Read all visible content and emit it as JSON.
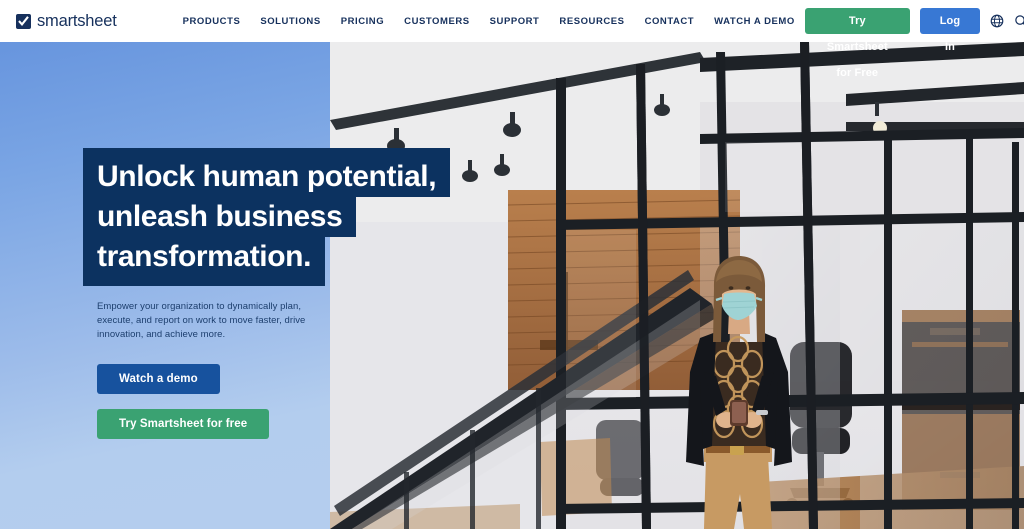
{
  "brand": {
    "name": "smartsheet",
    "logo_icon": "smartsheet-check-logo",
    "navy": "#16305c",
    "green": "#3aa272",
    "blue": "#3878d4"
  },
  "header": {
    "nav_items": [
      {
        "label": "PRODUCTS"
      },
      {
        "label": "SOLUTIONS"
      },
      {
        "label": "PRICING"
      },
      {
        "label": "CUSTOMERS"
      },
      {
        "label": "SUPPORT"
      },
      {
        "label": "RESOURCES"
      },
      {
        "label": "CONTACT"
      },
      {
        "label": "WATCH A DEMO"
      }
    ],
    "trial_button": "Try Smartsheet for Free",
    "login_button": "Log In",
    "globe_icon": "globe-icon",
    "search_icon": "search-icon"
  },
  "hero": {
    "headline_lines": [
      "Unlock human potential,",
      "unleash business",
      "transformation."
    ],
    "subcopy": "Empower your organization to dynamically plan, execute, and report on work to move faster, drive innovation, and achieve more.",
    "cta_demo": "Watch a demo",
    "cta_trial": "Try Smartsheet for free",
    "headline_bg": "#0c3260",
    "panel_gradient_from": "#6795de",
    "panel_gradient_to": "#b4cdee",
    "image_alt": "Woman wearing a face mask using a smartphone in a modern office with glass partitions and a staircase"
  }
}
